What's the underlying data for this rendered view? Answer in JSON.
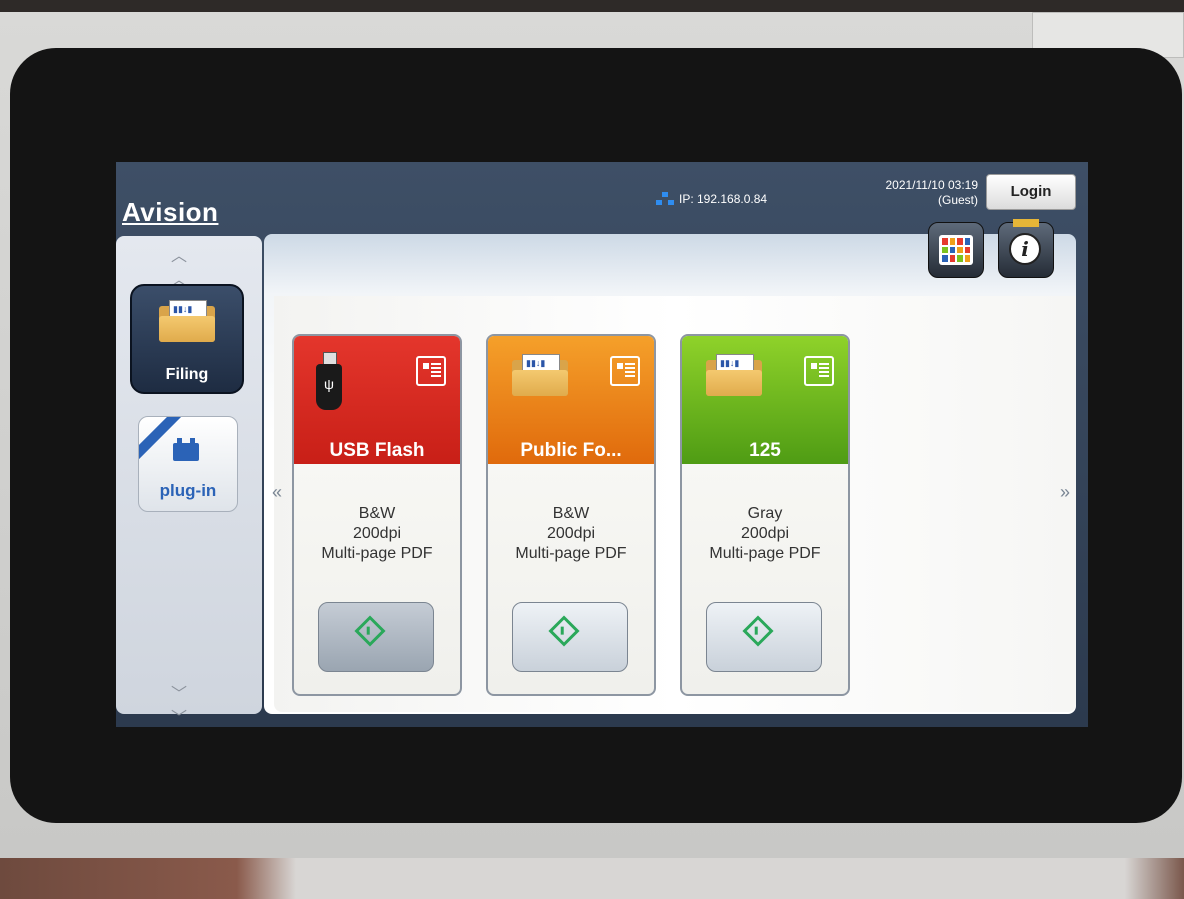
{
  "header": {
    "logo": "Avision",
    "network_icon": "network-icon",
    "ip": "IP: 192.168.0.84",
    "datetime": "2021/11/10 03:19",
    "user": "(Guest)",
    "login_label": "Login"
  },
  "sidebar": {
    "modes": [
      {
        "label": "Filing",
        "icon": "folder-icon",
        "selected": true
      },
      {
        "label": "plug-in",
        "icon": "plugin-icon",
        "selected": false
      }
    ],
    "up_icon": "scroll-up-icon",
    "down_icon": "scroll-down-icon"
  },
  "toolbar": {
    "grid_icon": "app-grid-icon",
    "info_icon": "info-icon"
  },
  "nav": {
    "prev": "«",
    "next": "»"
  },
  "cards": [
    {
      "title": "USB Flash",
      "icon": "usb-flash-icon",
      "color": "#d8261e",
      "color_dark": "#b41812",
      "color_mode": "B&W",
      "resolution": "200dpi",
      "format": "Multi-page PDF",
      "start_icon": "start-icon"
    },
    {
      "title": "Public Fo...",
      "icon": "folder-icon",
      "color": "#f08a18",
      "color_dark": "#d9660a",
      "color_mode": "B&W",
      "resolution": "200dpi",
      "format": "Multi-page PDF",
      "start_icon": "start-icon"
    },
    {
      "title": "125",
      "icon": "folder-icon",
      "color": "#7cc21e",
      "color_dark": "#4d9a12",
      "color_mode": "Gray",
      "resolution": "200dpi",
      "format": "Multi-page PDF",
      "start_icon": "start-icon"
    }
  ],
  "colors": {
    "screen_bg": "#2c3a4e",
    "accent_blue": "#2b63b7",
    "start_green": "#2aa85a"
  }
}
